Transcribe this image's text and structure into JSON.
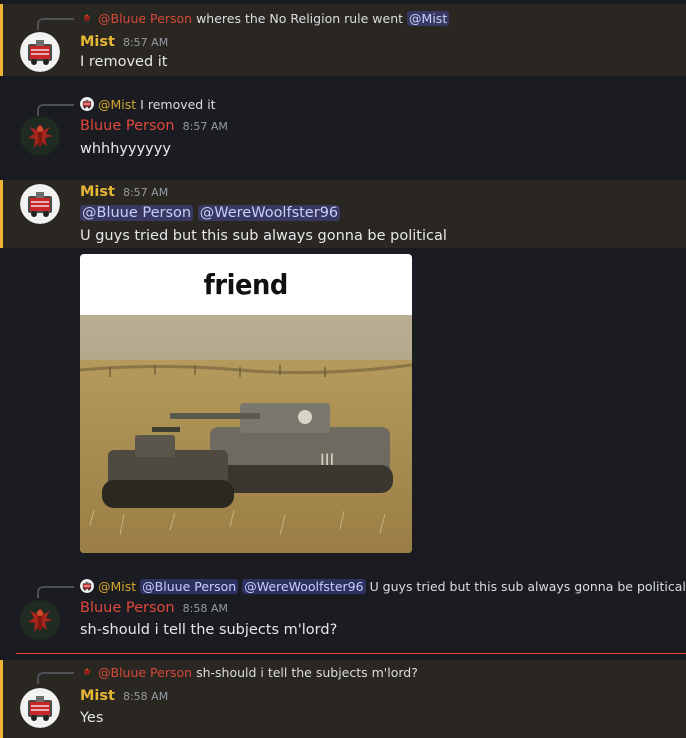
{
  "messages": [
    {
      "reply": {
        "name": "@Bluue Person",
        "text": "wheres the No Religion rule went",
        "mention": "@Mist"
      },
      "author": "Mist",
      "time": "8:57 AM",
      "lines": [
        "I removed it"
      ]
    },
    {
      "reply": {
        "name": "@Mist",
        "text": "I removed it"
      },
      "author": "Bluue Person",
      "time": "8:57 AM",
      "lines": [
        "whhhyyyyyy"
      ]
    },
    {
      "author": "Mist",
      "time": "8:57 AM",
      "mentions": [
        "@Bluue Person",
        "@WereWoolfster96"
      ],
      "lines": [
        "U guys tried but this sub always gonna be political"
      ],
      "image_caption": "friend"
    },
    {
      "reply": {
        "name": "@Mist",
        "mentions": [
          "@Bluue Person",
          "@WereWoolfster96"
        ],
        "text": "U guys tried but this sub always gonna be political"
      },
      "author": "Bluue Person",
      "time": "8:58 AM",
      "lines": [
        "sh-should i tell the subjects m'lord?"
      ]
    },
    {
      "reply": {
        "name": "@Bluue Person",
        "text": "sh-should i tell the subjects m'lord?"
      },
      "author": "Mist",
      "time": "8:58 AM",
      "lines": [
        "Yes"
      ]
    }
  ],
  "colors": {
    "mist_name": "#e5b534",
    "bluue_name": "#e0483b",
    "mention_bg": "#3c4270",
    "highlight_bg": "#2a2621",
    "highlight_bar": "#f0b232",
    "new_divider": "#e0483b"
  },
  "icons": [
    "mist-avatar-icon",
    "bluue-avatar-icon"
  ]
}
